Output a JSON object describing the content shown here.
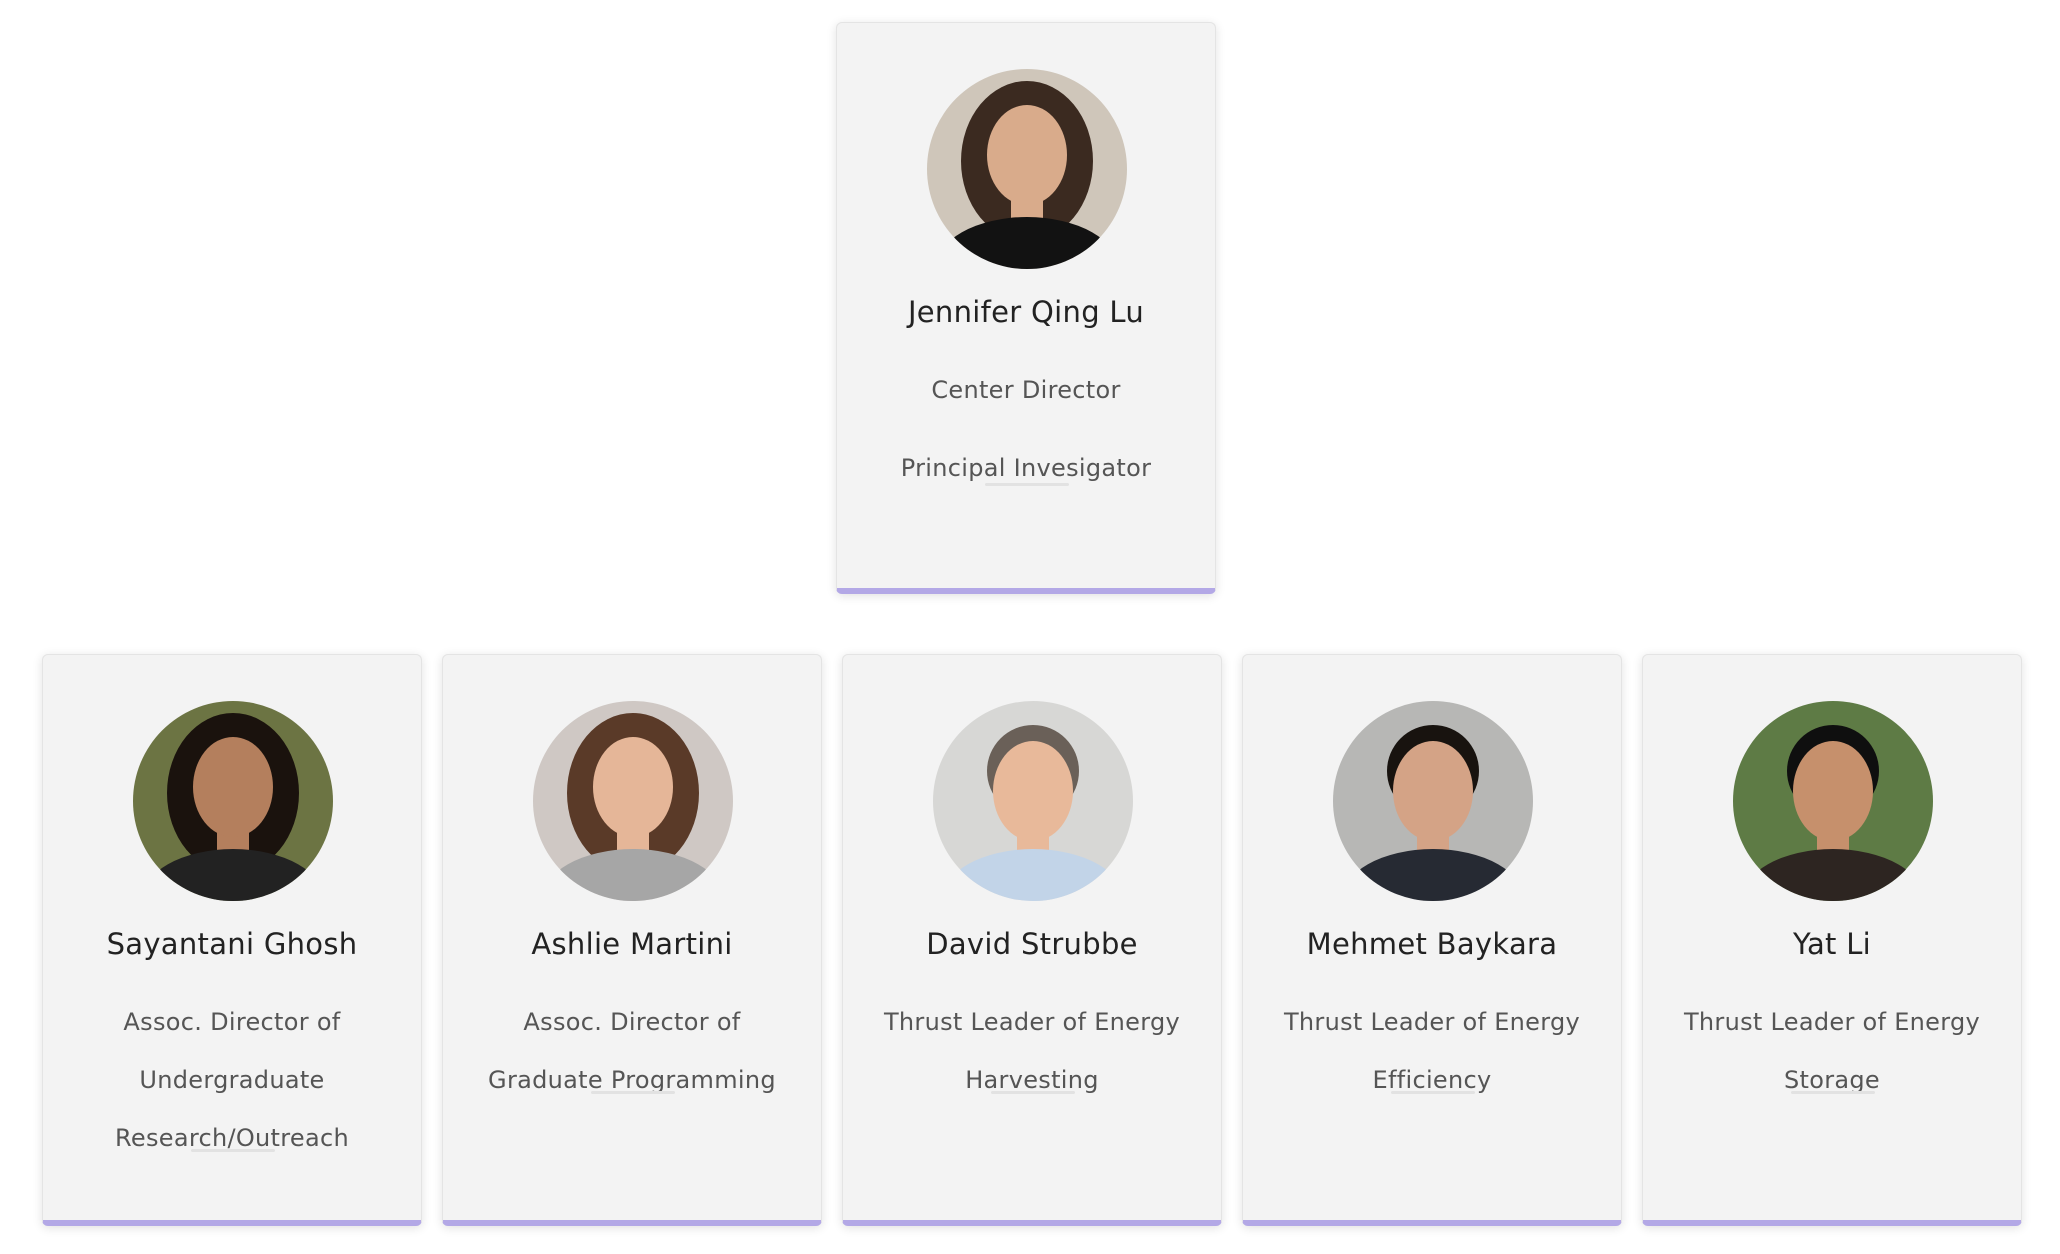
{
  "people": [
    {
      "name": "Jennifer Qing Lu",
      "role_lines": [
        "Center Director",
        "Principal Invesigator"
      ],
      "photo": {
        "bg": "#cfc6ba",
        "hair": "#3b2a20",
        "skin": "#d9ab8b",
        "shirt": "#121212"
      }
    },
    {
      "name": "Sayantani Ghosh",
      "role_lines": [
        "Assoc. Director of",
        "Undergraduate",
        "Research/Outreach"
      ],
      "photo": {
        "bg": "#6c7443",
        "hair": "#1a120d",
        "skin": "#b47f5d",
        "shirt": "#222222"
      }
    },
    {
      "name": "Ashlie Martini",
      "role_lines": [
        "Assoc. Director of",
        "Graduate Programming"
      ],
      "photo": {
        "bg": "#cfc8c4",
        "hair": "#5a3a28",
        "skin": "#e5b698",
        "shirt": "#a6a6a6"
      }
    },
    {
      "name": "David Strubbe",
      "role_lines": [
        "Thrust Leader of Energy",
        "Harvesting"
      ],
      "photo": {
        "bg": "#d7d7d5",
        "hair": "#6a6058",
        "skin": "#e8b99a",
        "shirt": "#c2d4e8"
      }
    },
    {
      "name": "Mehmet Baykara",
      "role_lines": [
        "Thrust Leader of Energy",
        "Efficiency"
      ],
      "photo": {
        "bg": "#b7b7b5",
        "hair": "#18130f",
        "skin": "#d4a386",
        "shirt": "#262a33"
      }
    },
    {
      "name": "Yat Li",
      "role_lines": [
        "Thrust Leader of Energy",
        "Storage"
      ],
      "photo": {
        "bg": "#5e7b45",
        "hair": "#0f0f0f",
        "skin": "#c6906c",
        "shirt": "#2d2521"
      }
    }
  ]
}
